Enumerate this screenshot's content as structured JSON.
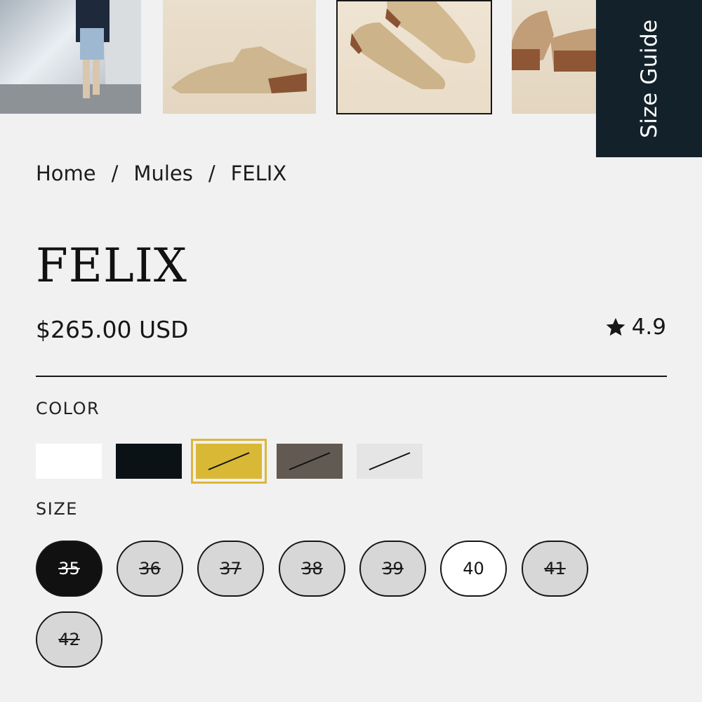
{
  "gallery": {
    "thumbnails": [
      {
        "alt": "model wearing mules"
      },
      {
        "alt": "mule side view"
      },
      {
        "alt": "pair of mules"
      },
      {
        "alt": "mules heel view"
      }
    ]
  },
  "size_guide_label": "Size Guide",
  "breadcrumb": {
    "home": "Home",
    "separator": "/",
    "category": "Mules",
    "current": "FELIX"
  },
  "product": {
    "title": "FELIX",
    "price": "$265.00 USD",
    "rating": "4.9",
    "rating_icon": "star-icon"
  },
  "color": {
    "label": "COLOR",
    "swatches": [
      {
        "hex": "#ffffff",
        "available": true,
        "selected": false
      },
      {
        "hex": "#0a1216",
        "available": true,
        "selected": false
      },
      {
        "hex": "#d9b836",
        "available": false,
        "selected": true
      },
      {
        "hex": "#625a52",
        "available": false,
        "selected": false
      },
      {
        "hex": "#e5e5e5",
        "available": false,
        "selected": false
      }
    ]
  },
  "size": {
    "label": "SIZE",
    "options": [
      {
        "value": "35",
        "state": "selected-sold-out"
      },
      {
        "value": "36",
        "state": "sold-out"
      },
      {
        "value": "37",
        "state": "sold-out"
      },
      {
        "value": "38",
        "state": "sold-out"
      },
      {
        "value": "39",
        "state": "sold-out"
      },
      {
        "value": "40",
        "state": "available"
      },
      {
        "value": "41",
        "state": "sold-out"
      },
      {
        "value": "42",
        "state": "sold-out"
      }
    ]
  }
}
